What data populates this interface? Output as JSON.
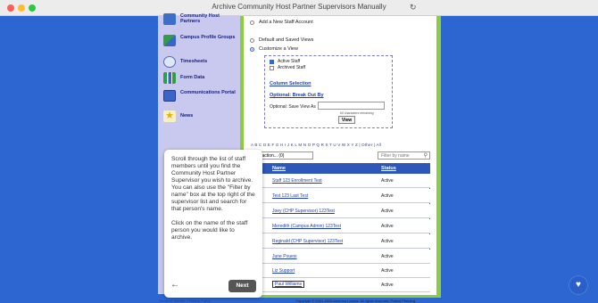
{
  "window": {
    "title": "Archive Community Host Partner Supervisors Manually"
  },
  "nav": {
    "items": [
      {
        "label": "Community Host Partners",
        "icon": "people-icon"
      },
      {
        "label": "Campus Profile Groups",
        "icon": "groups-icon"
      },
      {
        "label": "Timesheets",
        "icon": "clock-icon"
      },
      {
        "label": "Form Data",
        "icon": "chart-icon"
      },
      {
        "label": "Communications Portal",
        "icon": "portal-icon"
      },
      {
        "label": "News",
        "icon": "star-icon"
      }
    ]
  },
  "main": {
    "radios": [
      {
        "label": "Add a New Staff Account",
        "selected": false
      },
      {
        "label": "Default and Saved Views",
        "selected": false
      },
      {
        "label": "Customize a View",
        "selected": true
      }
    ],
    "customize": {
      "checkboxes": [
        {
          "label": "Active Staff",
          "checked": true
        },
        {
          "label": "Archived Staff",
          "checked": false
        }
      ],
      "column_selection": "Column Selection",
      "break_out_by": "Optional: Break Out By",
      "save_view_label": "Optional: Save View As",
      "chars_remaining": "60 characters remaining",
      "view_button": "View"
    },
    "alphabet": "A B C D E F G H I J K L M N O P Q R S T U V W X Y Z | Other | All",
    "action_select": "...ct action... (0)",
    "filter_placeholder": "Filter by name",
    "table": {
      "headers": {
        "name": "Name",
        "status": "Status"
      },
      "rows": [
        {
          "name": "Staff 123 Enrollment Test",
          "status": "Active"
        },
        {
          "name": "Test 123 Last Test",
          "status": "Active"
        },
        {
          "name": "Joey (CHP Supervisor) 123Test",
          "status": "Active"
        },
        {
          "name": "Meredith (Campus Admin) 123Test",
          "status": "Active"
        },
        {
          "name": "Reginald (CHP Supervisor) 123Test",
          "status": "Active"
        },
        {
          "name": "June Pouesi",
          "status": "Active"
        },
        {
          "name": "Liz Support",
          "status": "Active"
        },
        {
          "name": "Paul Williams",
          "status": "Active"
        }
      ]
    }
  },
  "footer": {
    "links": "Terms of Service | Privacy Policy",
    "copyright": "Copyright © 2001-2025 America Learns. All rights reserved. Patent Pending."
  },
  "tooltip": {
    "paragraph1": "Scroll through the list of staff members until you find the Community Host Partner Supervisor you wish to archive. You can also use the \"Filter by name\" box at the top right of the supervisor list and search for that person's name.",
    "paragraph2": "Click on the name of the staff person you would like to archive.",
    "next_label": "Next"
  },
  "colors": {
    "page_background": "#2e66d1",
    "nav_background": "#c9c8ee",
    "frame_green": "#8ccc3f",
    "table_header": "#2d57b8"
  }
}
